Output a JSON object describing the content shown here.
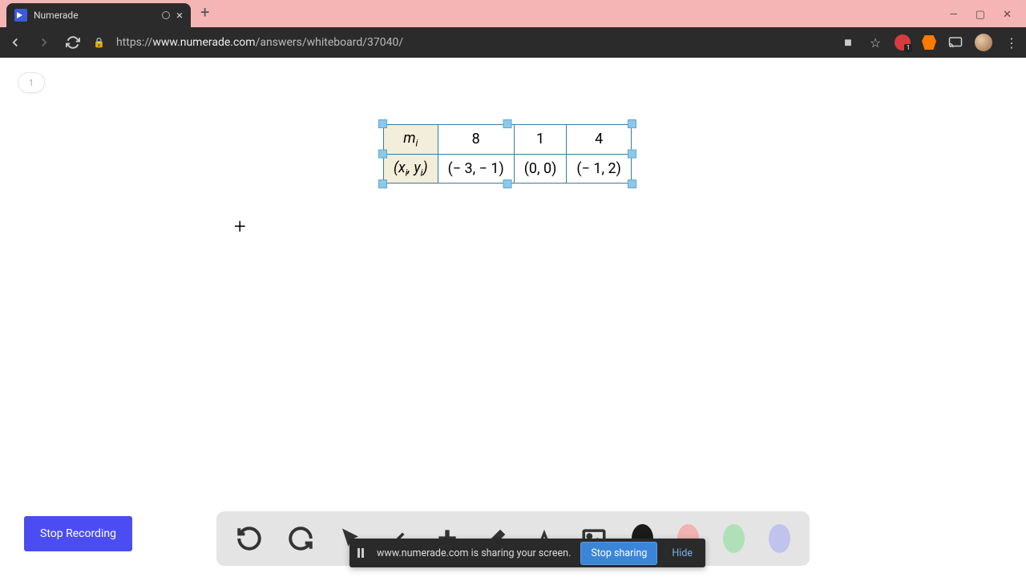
{
  "browser": {
    "tab_title": "Numerade",
    "url_protocol": "https://",
    "url_domain": "www.numerade.com",
    "url_path": "/answers/whiteboard/37040/",
    "new_tab": "+"
  },
  "page": {
    "slide_number": "1"
  },
  "table": {
    "row1_header": "m",
    "row1_header_sub": "i",
    "row1": [
      "8",
      "1",
      "4"
    ],
    "row2_header_open": "(x",
    "row2_header_sub1": "i",
    "row2_header_mid": ", y",
    "row2_header_sub2": "i",
    "row2_header_close": ")",
    "row2": [
      "(− 3, − 1)",
      "(0, 0)",
      "(− 1, 2)"
    ]
  },
  "toolbar": {
    "stop_recording": "Stop Recording"
  },
  "share": {
    "message": "www.numerade.com is sharing your screen.",
    "stop": "Stop sharing",
    "hide": "Hide"
  }
}
